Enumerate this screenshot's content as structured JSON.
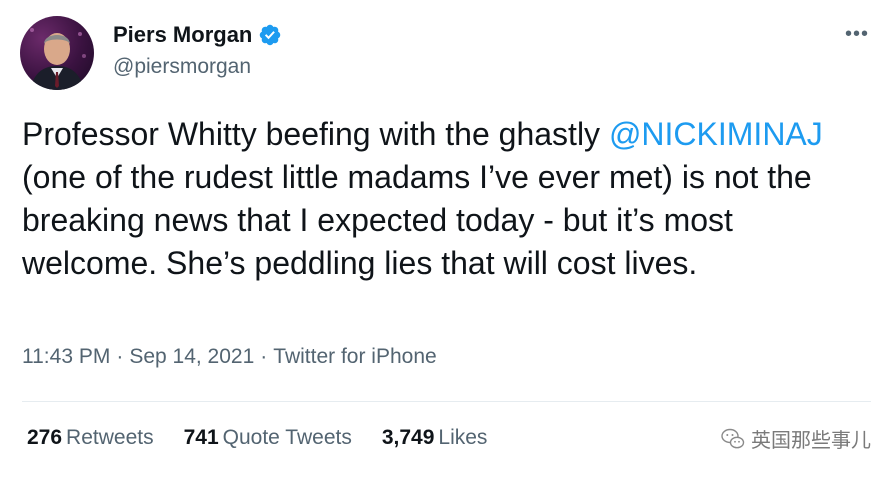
{
  "author": {
    "name": "Piers Morgan",
    "handle": "@piersmorgan",
    "verified_icon": "verified-badge-icon",
    "avatar_icon": "avatar"
  },
  "more_icon": "more-dots-icon",
  "tweet": {
    "text_before_mention": "Professor Whitty beefing with the ghastly ",
    "mention": "@NICKIMINAJ",
    "text_after_mention": " (one of the rudest little madams I’ve ever met) is not the breaking news that I expected today - but it’s most welcome. She’s peddling lies that will cost lives."
  },
  "meta": {
    "time": "11:43 PM",
    "separator1": "·",
    "date": "Sep 14, 2021",
    "separator2": "·",
    "source": "Twitter for iPhone"
  },
  "stats": {
    "retweets_count": "276",
    "retweets_label": "Retweets",
    "quotes_count": "741",
    "quotes_label": "Quote Tweets",
    "likes_count": "3,749",
    "likes_label": "Likes"
  },
  "watermark": {
    "text": "英国那些事儿",
    "icon": "wechat-icon"
  },
  "colors": {
    "link": "#1d9bf0",
    "secondary_text": "#536471",
    "primary_text": "#0f1419",
    "verified": "#1d9bf0"
  }
}
